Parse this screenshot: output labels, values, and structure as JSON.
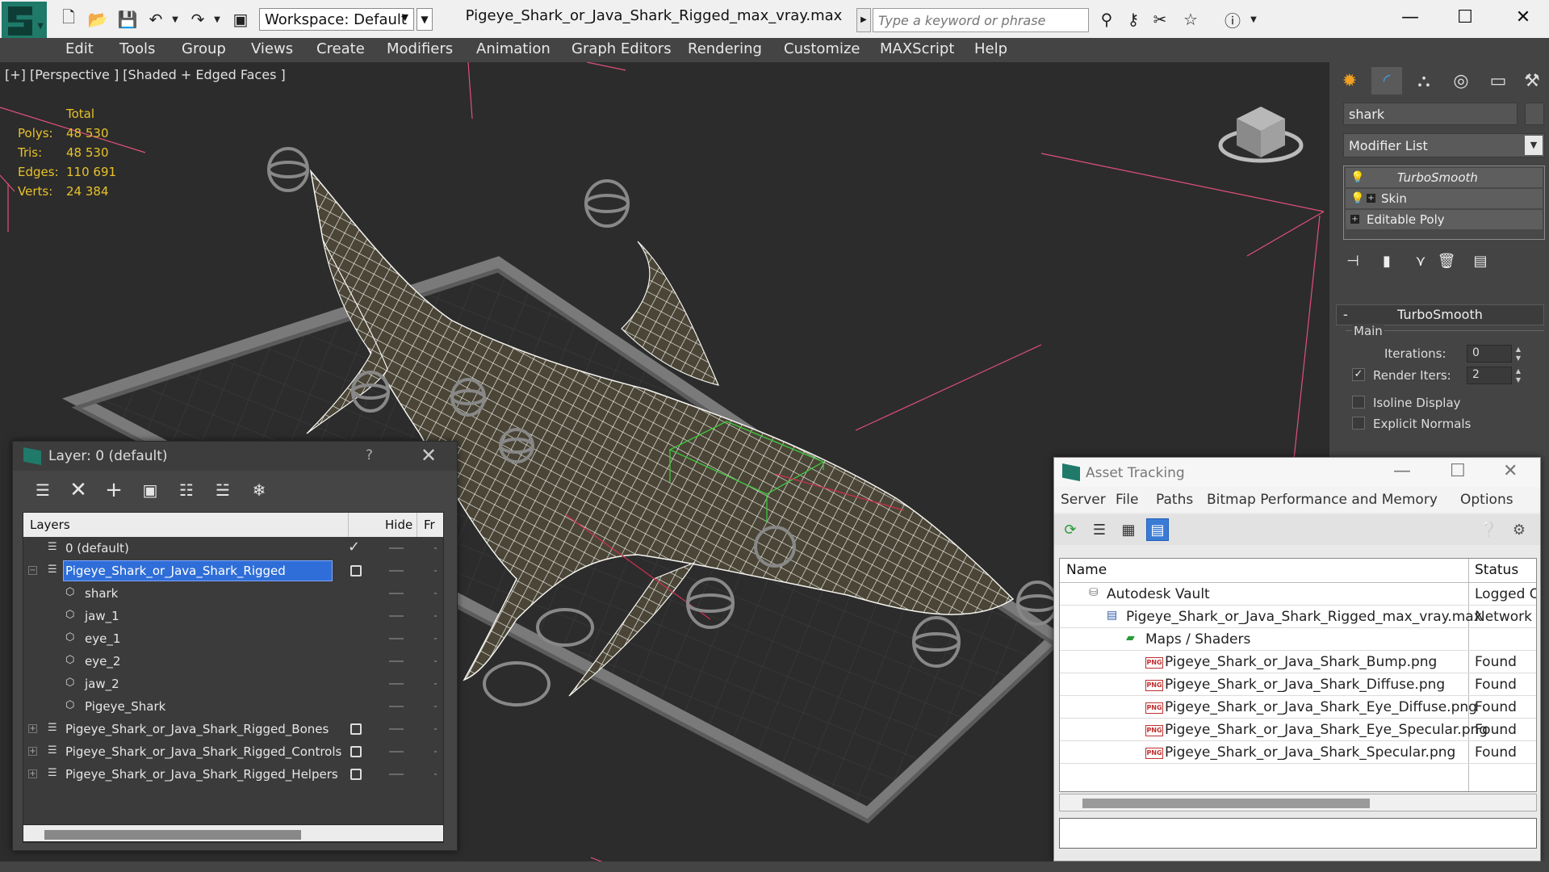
{
  "titlebar": {
    "workspace_label": "Workspace: Default",
    "document_title": "Pigeye_Shark_or_Java_Shark_Rigged_max_vray.max",
    "search_placeholder": "Type a keyword or phrase"
  },
  "menubar": {
    "items": [
      "Edit",
      "Tools",
      "Group",
      "Views",
      "Create",
      "Modifiers",
      "Animation",
      "Graph Editors",
      "Rendering",
      "Customize",
      "MAXScript",
      "Help"
    ]
  },
  "viewport": {
    "label": "[+] [Perspective ] [Shaded + Edged Faces ]",
    "stats": {
      "header": "Total",
      "polys_label": "Polys:",
      "polys": "48 530",
      "tris_label": "Tris:",
      "tris": "48 530",
      "edges_label": "Edges:",
      "edges": "110 691",
      "verts_label": "Verts:",
      "verts": "24 384"
    }
  },
  "command_panel": {
    "object_name": "shark",
    "modifier_list_label": "Modifier List",
    "stack": [
      "TurboSmooth",
      "Skin",
      "Editable Poly"
    ],
    "rollout_title": "TurboSmooth",
    "main_label": "Main",
    "iterations_label": "Iterations:",
    "iterations_value": "0",
    "render_iters_label": "Render Iters:",
    "render_iters_value": "2",
    "isoline_label": "Isoline Display",
    "explicit_normals_label": "Explicit Normals"
  },
  "layer_dialog": {
    "title": "Layer: 0 (default)",
    "help_label": "?",
    "columns": {
      "layers": "Layers",
      "hide": "Hide",
      "freeze": "Fr"
    },
    "rows": [
      {
        "name": "0 (default)"
      },
      {
        "name": "Pigeye_Shark_or_Java_Shark_Rigged"
      },
      {
        "name": "shark"
      },
      {
        "name": "jaw_1"
      },
      {
        "name": "eye_1"
      },
      {
        "name": "eye_2"
      },
      {
        "name": "jaw_2"
      },
      {
        "name": "Pigeye_Shark"
      },
      {
        "name": "Pigeye_Shark_or_Java_Shark_Rigged_Bones"
      },
      {
        "name": "Pigeye_Shark_or_Java_Shark_Rigged_Controls"
      },
      {
        "name": "Pigeye_Shark_or_Java_Shark_Rigged_Helpers"
      }
    ]
  },
  "asset_dialog": {
    "title": "Asset Tracking",
    "menu": [
      "Server",
      "File",
      "Paths",
      "Bitmap Performance and Memory",
      "Options"
    ],
    "columns": {
      "name": "Name",
      "status": "Status"
    },
    "rows": [
      {
        "name": "Autodesk Vault",
        "status": "Logged O"
      },
      {
        "name": "Pigeye_Shark_or_Java_Shark_Rigged_max_vray.max",
        "status": "Network F"
      },
      {
        "name": "Maps / Shaders",
        "status": ""
      },
      {
        "name": "Pigeye_Shark_or_Java_Shark_Bump.png",
        "status": "Found"
      },
      {
        "name": "Pigeye_Shark_or_Java_Shark_Diffuse.png",
        "status": "Found"
      },
      {
        "name": "Pigeye_Shark_or_Java_Shark_Eye_Diffuse.png",
        "status": "Found"
      },
      {
        "name": "Pigeye_Shark_or_Java_Shark_Eye_Specular.png",
        "status": "Found"
      },
      {
        "name": "Pigeye_Shark_or_Java_Shark_Specular.png",
        "status": "Found"
      }
    ]
  },
  "colors": {
    "selection_blue": "#2f6ed8",
    "stats_yellow": "#e8c22a",
    "app_teal": "#1f7a6a",
    "wire_white": "#ffffff",
    "guide_pink": "#e0507a"
  }
}
